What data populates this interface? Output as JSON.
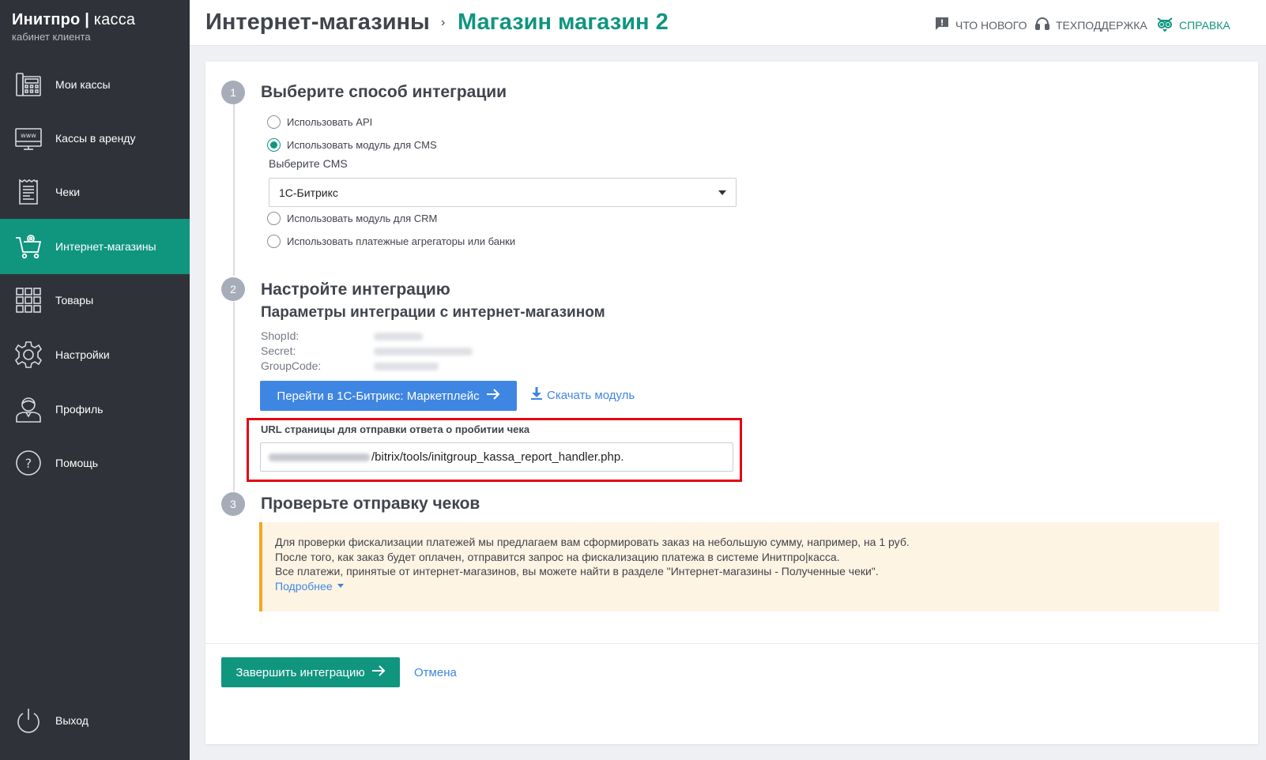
{
  "brand": {
    "name_bold": "Инитпро",
    "separator": "|",
    "name_thin": "касса",
    "subtitle": "кабинет клиента"
  },
  "sidebar": {
    "items": [
      {
        "label": "Мои кассы",
        "icon": "cash-register-icon",
        "active": false
      },
      {
        "label": "Кассы в аренду",
        "icon": "www-terminal-icon",
        "active": false
      },
      {
        "label": "Чеки",
        "icon": "receipt-icon",
        "active": false
      },
      {
        "label": "Интернет-магазины",
        "icon": "shopping-cart-icon",
        "active": true
      },
      {
        "label": "Товары",
        "icon": "grid-icon",
        "active": false
      },
      {
        "label": "Настройки",
        "icon": "gear-icon",
        "active": false
      },
      {
        "label": "Профиль",
        "icon": "user-icon",
        "active": false
      },
      {
        "label": "Помощь",
        "icon": "help-icon",
        "active": false
      }
    ],
    "logout": {
      "label": "Выход",
      "icon": "power-icon"
    }
  },
  "header": {
    "breadcrumb_parent": "Интернет-магазины",
    "breadcrumb_separator": "›",
    "breadcrumb_current": "Магазин магазин 2",
    "links": {
      "whats_new": "ЧТО НОВОГО",
      "support": "ТЕХПОДДЕРЖКА",
      "help": "СПРАВКА"
    }
  },
  "step1": {
    "number": "1",
    "title": "Выберите способ интеграции",
    "options": {
      "api": "Использовать API",
      "cms": "Использовать модуль для CMS",
      "crm": "Использовать модуль для CRM",
      "aggregators": "Использовать платежные агрегаторы или банки"
    },
    "selected": "cms",
    "cms_label": "Выберите CMS",
    "cms_value": "1С-Битрикс"
  },
  "step2": {
    "number": "2",
    "title": "Настройте интеграцию",
    "subtitle": "Параметры интеграции с интернет-магазином",
    "params": {
      "shopid_key": "ShopId:",
      "secret_key": "Secret:",
      "groupcode_key": "GroupCode:"
    },
    "marketplace_button": "Перейти в 1С-Битрикс: Маркетплейс",
    "download_link": "Скачать модуль",
    "url_label": "URL страницы для отправки ответа о пробитии чека",
    "url_suffix": "/bitrix/tools/initgroup_kassa_report_handler.php."
  },
  "step3": {
    "number": "3",
    "title": "Проверьте отправку чеков",
    "info_line1": "Для проверки фискализации платежей мы предлагаем вам сформировать заказ на небольшую сумму, например, на 1 руб.",
    "info_line2": "После того, как заказ будет оплачен, отправится запрос на фискализацию платежа в системе Инитпро|касса.",
    "info_line3": "Все платежи, принятые от интернет-магазинов, вы можете найти в разделе \"Интернет-магазины - Полученные чеки\".",
    "more_link": "Подробнее"
  },
  "footer": {
    "finish_button": "Завершить интеграцию",
    "cancel_link": "Отмена"
  },
  "colors": {
    "accent": "#10957f",
    "sidebar_bg": "#2f3238",
    "link_blue": "#3f86e2",
    "highlight_red": "#e30613",
    "info_bg": "#fef4e3",
    "info_border": "#f5a623"
  }
}
